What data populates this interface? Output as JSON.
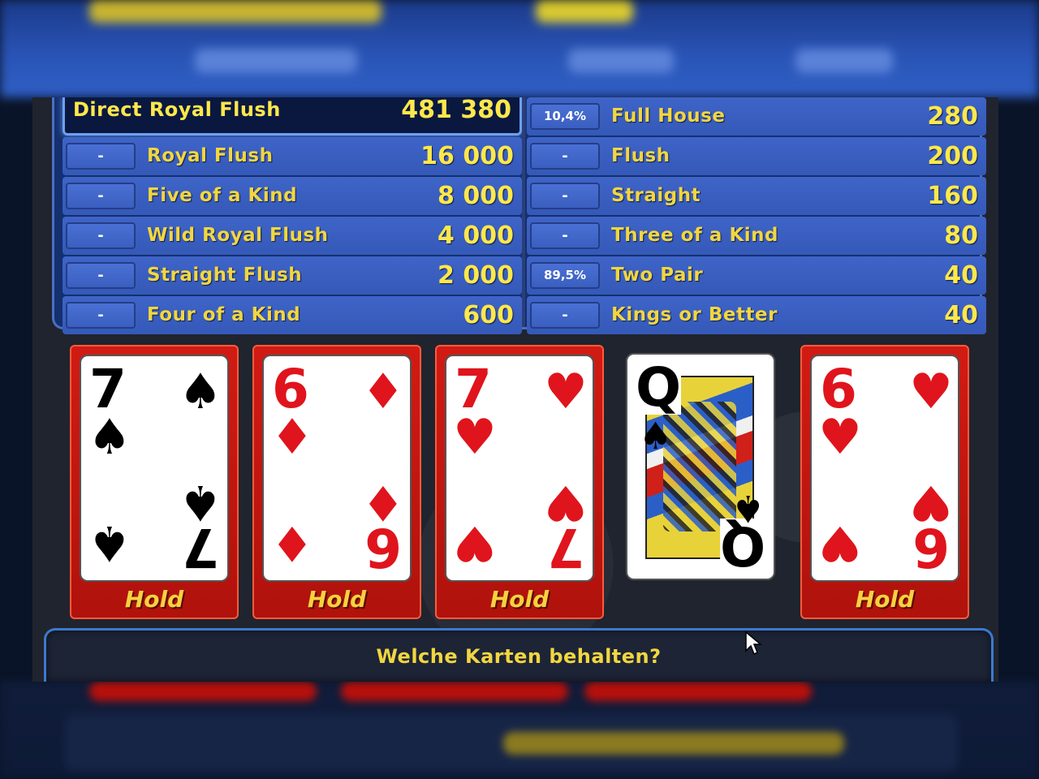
{
  "paytable": {
    "left": [
      {
        "badge": "",
        "name": "Direct Royal Flush",
        "value": "481 380",
        "highlight": true
      },
      {
        "badge": "-",
        "name": "Royal Flush",
        "value": "16 000"
      },
      {
        "badge": "-",
        "name": "Five of a Kind",
        "value": "8 000"
      },
      {
        "badge": "-",
        "name": "Wild Royal Flush",
        "value": "4 000"
      },
      {
        "badge": "-",
        "name": "Straight Flush",
        "value": "2 000"
      },
      {
        "badge": "-",
        "name": "Four of a Kind",
        "value": "600"
      }
    ],
    "right": [
      {
        "badge": "10,4%",
        "name": "Full House",
        "value": "280"
      },
      {
        "badge": "-",
        "name": "Flush",
        "value": "200"
      },
      {
        "badge": "-",
        "name": "Straight",
        "value": "160"
      },
      {
        "badge": "-",
        "name": "Three of a Kind",
        "value": "80"
      },
      {
        "badge": "89,5%",
        "name": "Two Pair",
        "value": "40"
      },
      {
        "badge": "-",
        "name": "Kings or Better",
        "value": "40"
      }
    ]
  },
  "cards": [
    {
      "rank": "7",
      "suit": "♠",
      "color": "black",
      "held": true,
      "hold_label": "Hold"
    },
    {
      "rank": "6",
      "suit": "♦",
      "color": "red",
      "held": true,
      "hold_label": "Hold"
    },
    {
      "rank": "7",
      "suit": "♥",
      "color": "red",
      "held": true,
      "hold_label": "Hold"
    },
    {
      "rank": "Q",
      "suit": "♠",
      "color": "black",
      "held": false,
      "hold_label": ""
    },
    {
      "rank": "6",
      "suit": "♥",
      "color": "red",
      "held": true,
      "hold_label": "Hold"
    }
  ],
  "message": "Welche Karten behalten?",
  "colors": {
    "accent_yellow": "#f2d640",
    "hold_red": "#d11b14",
    "table_blue": "#3459b8"
  },
  "icons": {
    "cursor": "arrow-cursor-icon"
  }
}
